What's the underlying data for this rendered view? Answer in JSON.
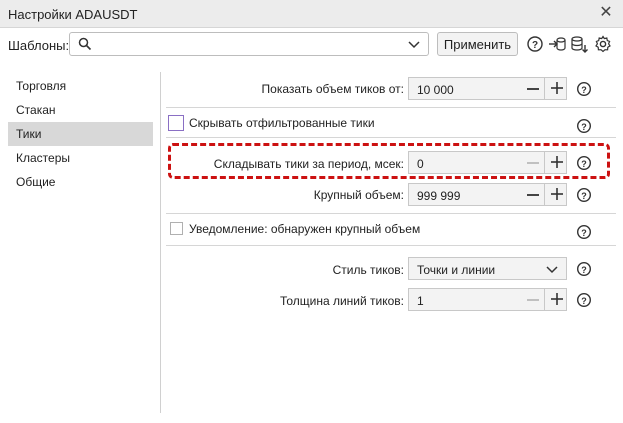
{
  "window": {
    "title": "Настройки ADAUSDT",
    "close_icon": "close-icon"
  },
  "templates": {
    "label": "Шаблоны:",
    "value": "",
    "apply_label": "Применить"
  },
  "nav": {
    "items": [
      {
        "label": "Торговля"
      },
      {
        "label": "Стакан"
      },
      {
        "label": "Тики",
        "active": true
      },
      {
        "label": "Кластеры"
      },
      {
        "label": "Общие"
      }
    ]
  },
  "settings": {
    "show_volume": {
      "label": "Показать объем тиков от:",
      "value": "10 000"
    },
    "hide_filtered": {
      "label": "Скрывать отфильтрованные тики",
      "checked": false
    },
    "fold_period": {
      "label": "Складывать тики за период, мсек:",
      "value": "0"
    },
    "large_volume": {
      "label": "Крупный объем:",
      "value": "999 999"
    },
    "notify_large": {
      "label": "Уведомление: обнаружен крупный объем",
      "checked": false
    },
    "tick_style": {
      "label": "Стиль тиков:",
      "value": "Точки и линии"
    },
    "line_width": {
      "label": "Толщина линий тиков:",
      "value": "1"
    }
  },
  "colors": {
    "highlight": "#cc1111",
    "active_nav": "#d8d8d8"
  }
}
